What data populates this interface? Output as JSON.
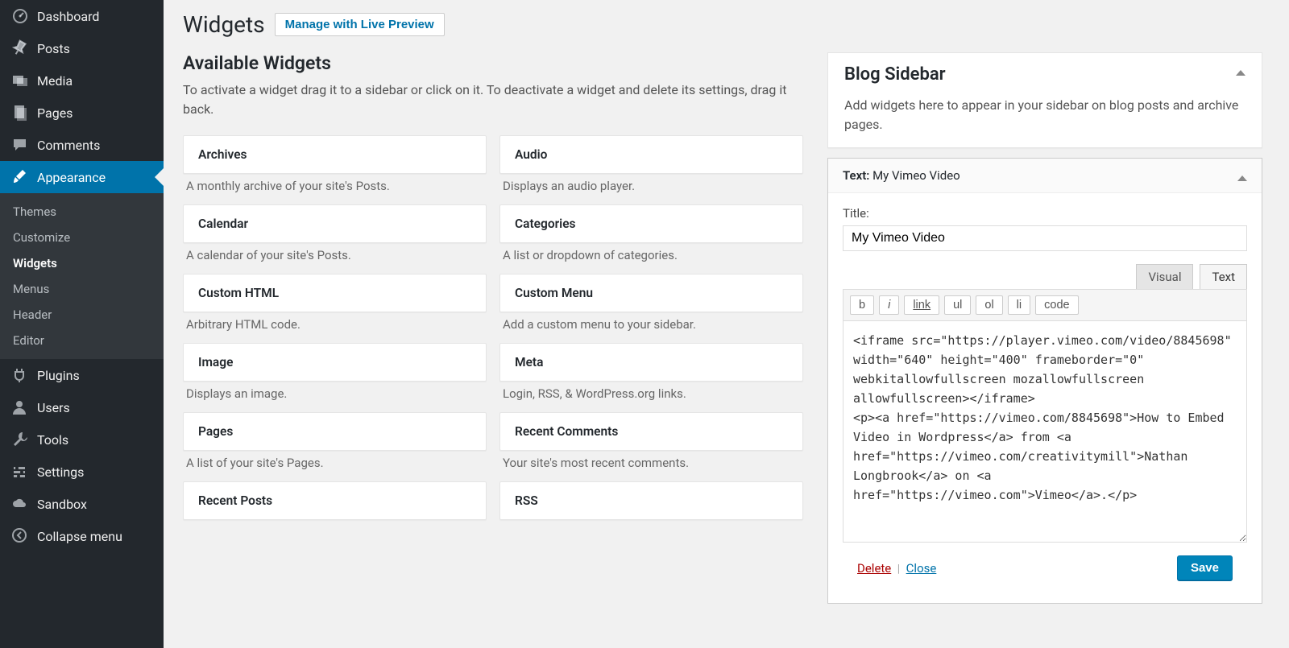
{
  "nav": {
    "items": [
      {
        "label": "Dashboard",
        "icon": "dashboard"
      },
      {
        "label": "Posts",
        "icon": "pin"
      },
      {
        "label": "Media",
        "icon": "media"
      },
      {
        "label": "Pages",
        "icon": "pages"
      },
      {
        "label": "Comments",
        "icon": "comments"
      },
      {
        "label": "Appearance",
        "icon": "brush",
        "active": true
      },
      {
        "label": "Plugins",
        "icon": "plugin"
      },
      {
        "label": "Users",
        "icon": "user"
      },
      {
        "label": "Tools",
        "icon": "tools"
      },
      {
        "label": "Settings",
        "icon": "settings"
      },
      {
        "label": "Sandbox",
        "icon": "cloud"
      }
    ],
    "submenu": [
      "Themes",
      "Customize",
      "Widgets",
      "Menus",
      "Header",
      "Editor"
    ],
    "submenu_current": "Widgets",
    "collapse": "Collapse menu"
  },
  "page": {
    "title": "Widgets",
    "preview_button": "Manage with Live Preview",
    "available_heading": "Available Widgets",
    "available_description": "To activate a widget drag it to a sidebar or click on it. To deactivate a widget and delete its settings, drag it back."
  },
  "widgets": [
    {
      "name": "Archives",
      "desc": "A monthly archive of your site's Posts."
    },
    {
      "name": "Audio",
      "desc": "Displays an audio player."
    },
    {
      "name": "Calendar",
      "desc": "A calendar of your site's Posts."
    },
    {
      "name": "Categories",
      "desc": "A list or dropdown of categories."
    },
    {
      "name": "Custom HTML",
      "desc": "Arbitrary HTML code."
    },
    {
      "name": "Custom Menu",
      "desc": "Add a custom menu to your sidebar."
    },
    {
      "name": "Image",
      "desc": "Displays an image."
    },
    {
      "name": "Meta",
      "desc": "Login, RSS, & WordPress.org links."
    },
    {
      "name": "Pages",
      "desc": "A list of your site's Pages."
    },
    {
      "name": "Recent Comments",
      "desc": "Your site's most recent comments."
    },
    {
      "name": "Recent Posts",
      "desc": ""
    },
    {
      "name": "RSS",
      "desc": ""
    }
  ],
  "sidebar_area": {
    "title": "Blog Sidebar",
    "description": "Add widgets here to appear in your sidebar on blog posts and archive pages."
  },
  "instance": {
    "type_label": "Text:",
    "title_in_header": "My Vimeo Video",
    "title_label": "Title:",
    "title_value": "My Vimeo Video",
    "tabs": {
      "visual": "Visual",
      "text": "Text"
    },
    "tools": {
      "b": "b",
      "i": "i",
      "link": "link",
      "ul": "ul",
      "ol": "ol",
      "li": "li",
      "code": "code"
    },
    "textarea": "<iframe src=\"https://player.vimeo.com/video/8845698\" width=\"640\" height=\"400\" frameborder=\"0\" webkitallowfullscreen mozallowfullscreen allowfullscreen></iframe>\n<p><a href=\"https://vimeo.com/8845698\">How to Embed Video in Wordpress</a> from <a href=\"https://vimeo.com/creativitymill\">Nathan Longbrook</a> on <a href=\"https://vimeo.com\">Vimeo</a>.</p>",
    "delete": "Delete",
    "close": "Close",
    "save": "Save"
  }
}
